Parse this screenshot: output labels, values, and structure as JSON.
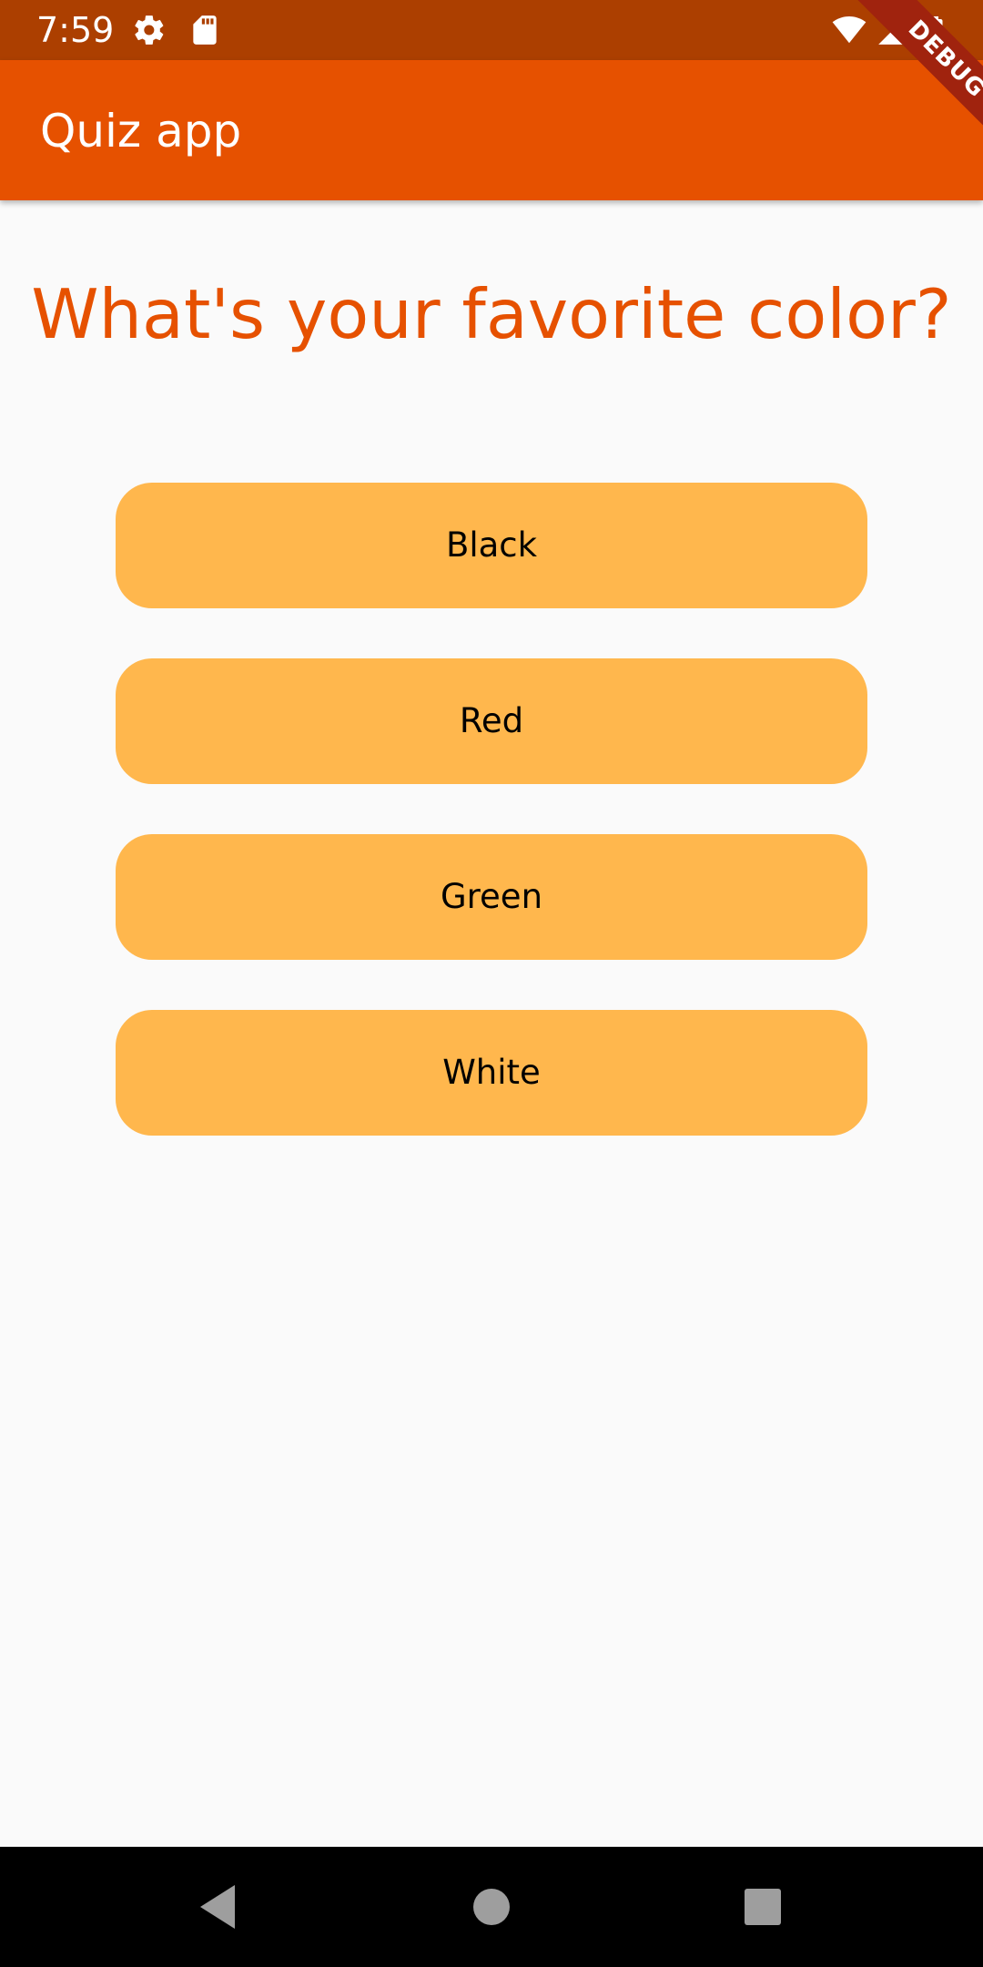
{
  "status_bar": {
    "time": "7:59",
    "icons": [
      "gear-icon",
      "sd-card-icon",
      "wifi-icon",
      "signal-icon",
      "battery-icon"
    ]
  },
  "app_bar": {
    "title": "Quiz app"
  },
  "debug_banner": {
    "label": "DEBUG"
  },
  "question": {
    "text": "What's your favorite color?"
  },
  "answers": [
    {
      "label": "Black"
    },
    {
      "label": "Red"
    },
    {
      "label": "Green"
    },
    {
      "label": "White"
    }
  ],
  "nav_bar": {
    "icons": [
      "back-icon",
      "home-icon",
      "recents-icon"
    ]
  },
  "colors": {
    "status_bar": "#ac3f00",
    "app_bar": "#e65100",
    "question_text": "#e65100",
    "answer_button": "#ffb74d",
    "background": "#fafafa",
    "debug_banner": "#a0230e",
    "nav_bar": "#000000"
  }
}
